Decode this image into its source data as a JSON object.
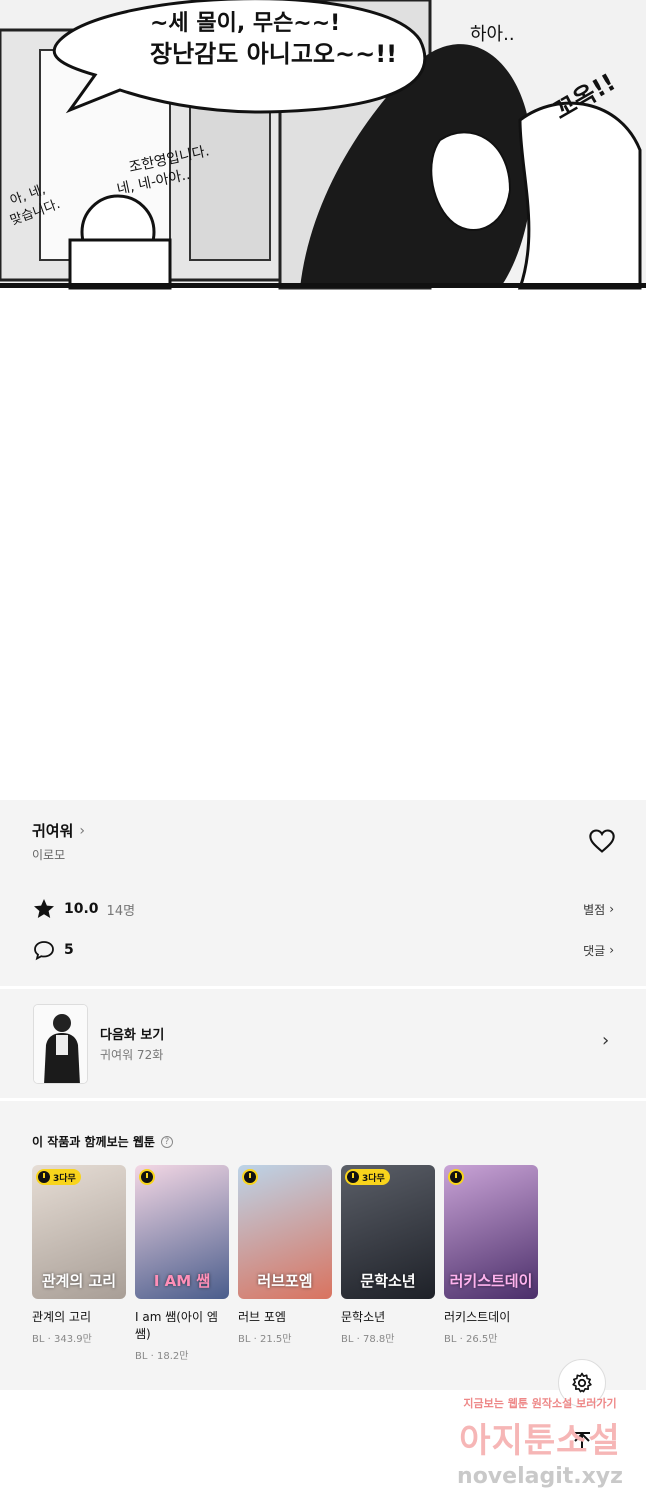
{
  "comic": {
    "bubble_line1": "~세 몰이, 무슨~~!",
    "bubble_line2": "장난감도 아니고오~~!!",
    "side_text_1": "조한영입니다.",
    "side_text_2": "네, 네-아아..",
    "side_text_3": "아, 네,",
    "side_text_4": "맞습니다.",
    "sfx_1": "하아..",
    "sfx_2": "꼬옥!!"
  },
  "work": {
    "title": "귀여워",
    "author": "이로모"
  },
  "rating": {
    "score": "10.0",
    "count": "14명",
    "action_label": "별점"
  },
  "comments": {
    "count": "5",
    "action_label": "댓글"
  },
  "next_episode": {
    "label": "다음화 보기",
    "subtitle": "귀여워 72화"
  },
  "recommendations": {
    "heading": "이 작품과 함께보는 웹툰",
    "help_icon": "?",
    "items": [
      {
        "title": "관계의 고리",
        "meta": "BL · 343.9만",
        "badge": "3다무",
        "cover_text": "관계의 고리",
        "color": "#c8c0b8"
      },
      {
        "title": "I am 쌤(아이 엠 쌤)",
        "meta": "BL · 18.2만",
        "badge": "",
        "cover_text": "I AM 쌤",
        "color": "#7d8fb3"
      },
      {
        "title": "러브 포엠",
        "meta": "BL · 21.5만",
        "badge": "",
        "cover_text": "러브포엠",
        "color": "#d98a7a"
      },
      {
        "title": "문학소년",
        "meta": "BL · 78.8만",
        "badge": "3다무",
        "cover_text": "문학소년",
        "color": "#3a3f4a"
      },
      {
        "title": "러키스트데이",
        "meta": "BL · 26.5만",
        "badge": "",
        "cover_text": "러키스트데이",
        "color": "#6a4a8a"
      }
    ]
  },
  "watermark": {
    "top": "지금보는 웹툰 원작소설 보러가기",
    "main": "아지툰소설",
    "url": "novelagit.xyz"
  },
  "icons": {
    "heart": "heart-icon",
    "star": "star-icon",
    "comment": "comment-bubble-icon",
    "settings": "gear-icon",
    "top": "arrow-up-icon"
  }
}
